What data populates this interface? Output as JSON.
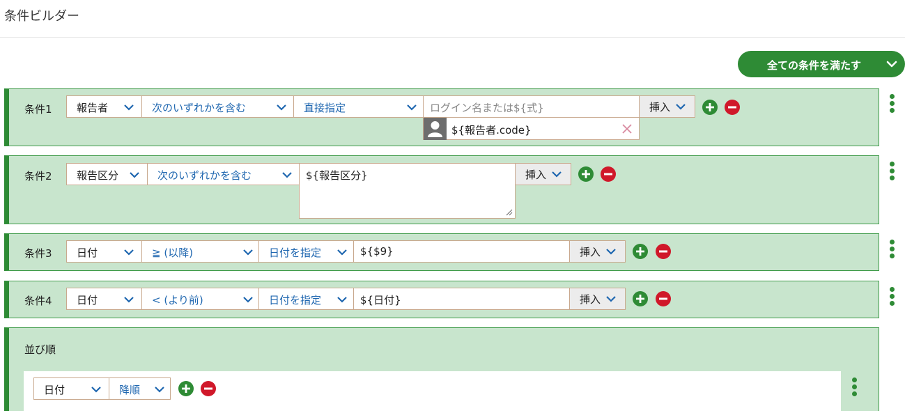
{
  "page": {
    "title": "条件ビルダー"
  },
  "match_mode": {
    "label": "全ての条件を満たす"
  },
  "insert_label": "挿入",
  "conditions": [
    {
      "label": "条件1",
      "field": "報告者",
      "operator": "次のいずれかを含む",
      "mode": "直接指定",
      "input_placeholder": "ログイン名または${式}",
      "chip": "${報告者.code}"
    },
    {
      "label": "条件2",
      "field": "報告区分",
      "operator": "次のいずれかを含む",
      "value": "${報告区分}"
    },
    {
      "label": "条件3",
      "field": "日付",
      "operator": "≧ (以降)",
      "mode": "日付を指定",
      "value": "${$9}"
    },
    {
      "label": "条件4",
      "field": "日付",
      "operator": "< (より前)",
      "mode": "日付を指定",
      "value": "${日付}"
    }
  ],
  "sort": {
    "title": "並び順",
    "field": "日付",
    "direction": "降順"
  },
  "colors": {
    "accent_green": "#2e8b35",
    "panel_bg": "#c8e5cd",
    "remove_red": "#d0182a",
    "link_blue": "#1f67b0"
  }
}
